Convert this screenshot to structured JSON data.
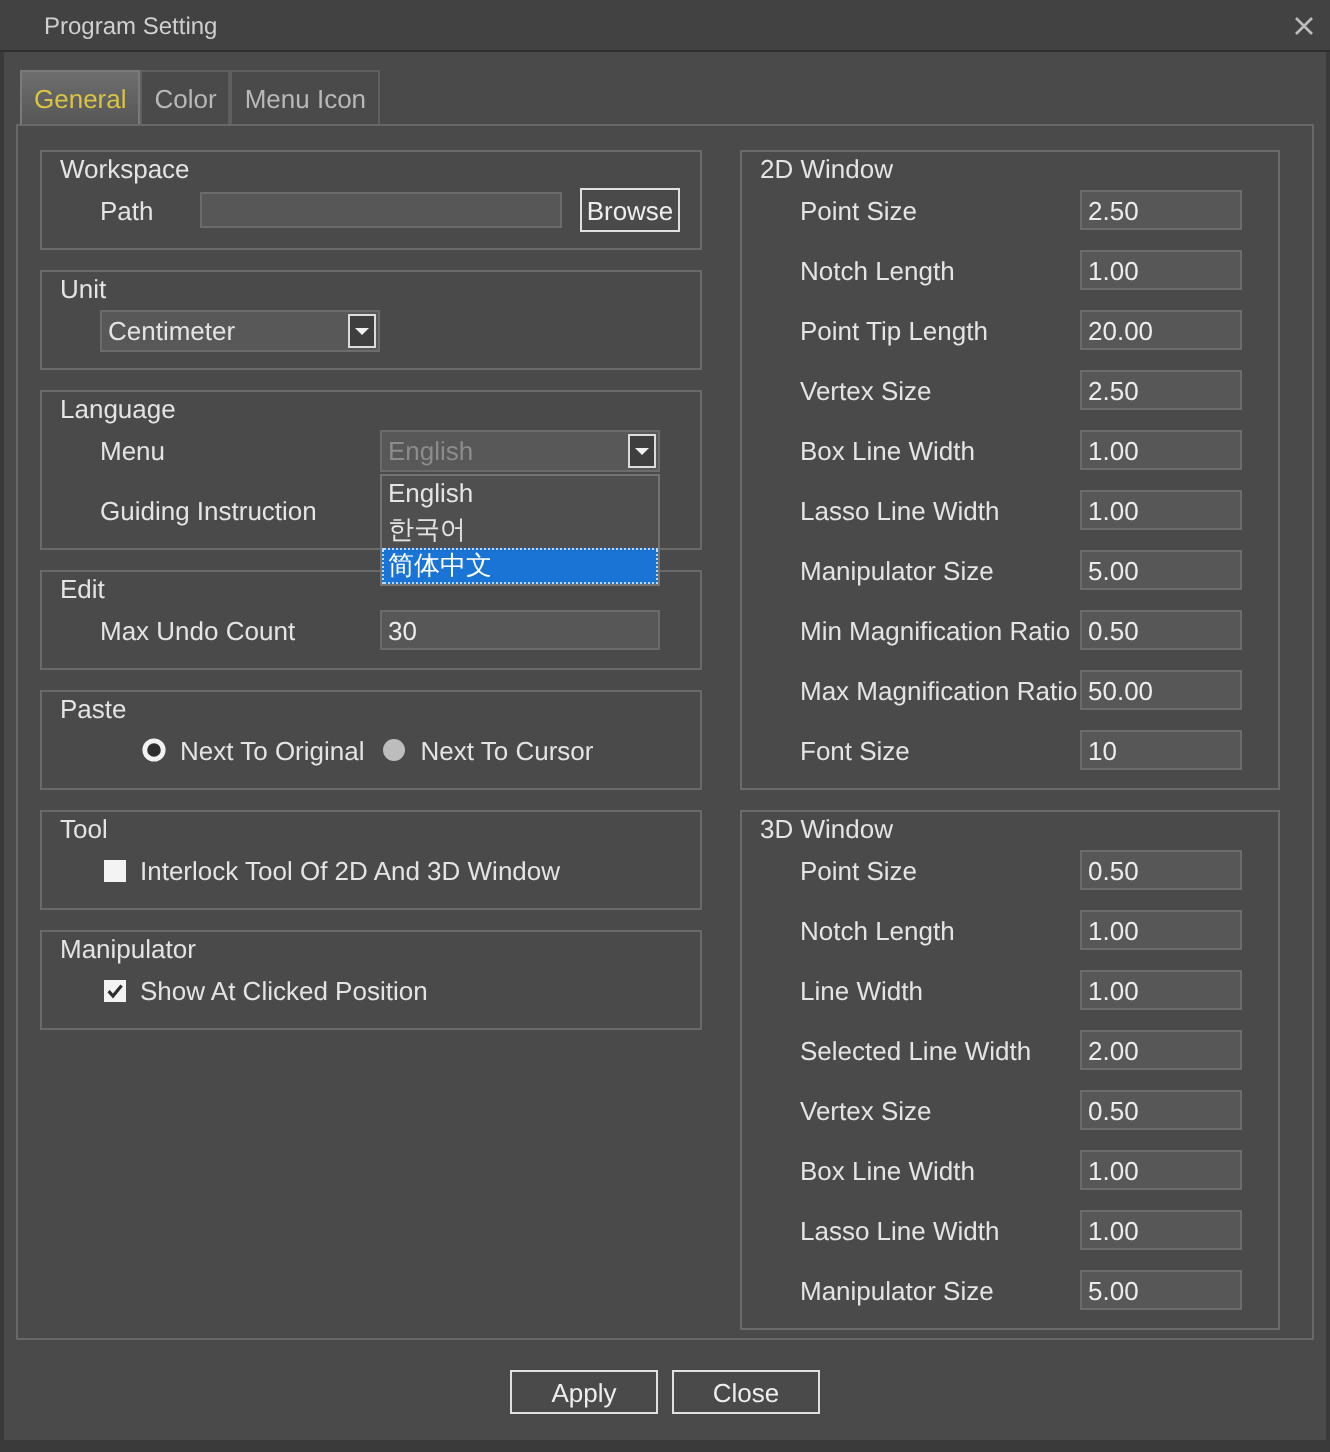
{
  "window": {
    "title": "Program Setting"
  },
  "tabs": [
    {
      "label": "General",
      "selected": true
    },
    {
      "label": "Color",
      "selected": false
    },
    {
      "label": "Menu Icon",
      "selected": false
    }
  ],
  "left_column": [
    {
      "title": "Workspace",
      "kind": "path",
      "label": "Path",
      "button": "Browse"
    },
    {
      "title": "Unit",
      "kind": "combo",
      "value": "Centimeter"
    },
    {
      "title": "Language",
      "kind": "combos",
      "rows": [
        {
          "label": "Menu",
          "value": "English",
          "disabled": true
        },
        {
          "label": "Guiding Instruction"
        }
      ],
      "popup": [
        {
          "label": "English",
          "selected": false
        },
        {
          "label": "한국어",
          "selected": false
        },
        {
          "label": "简体中文",
          "selected": true
        }
      ]
    },
    {
      "title": "Edit",
      "kind": "fields",
      "rows": [
        {
          "label": "Max Undo Count",
          "value": "30"
        }
      ]
    },
    {
      "title": "Paste",
      "kind": "radios",
      "options": [
        {
          "label": "Next To Original",
          "selected": true
        },
        {
          "label": "Next To Cursor",
          "selected": false
        }
      ]
    },
    {
      "title": "Tool",
      "kind": "checks",
      "options": [
        {
          "label": "Interlock Tool Of 2D And 3D Window",
          "checked": false
        }
      ]
    },
    {
      "title": "Manipulator",
      "kind": "checks",
      "options": [
        {
          "label": "Show At Clicked Position",
          "checked": true
        }
      ]
    }
  ],
  "right_column": [
    {
      "title": "2D Window",
      "kind": "fields",
      "rows": [
        {
          "label": "Point Size",
          "value": "2.50"
        },
        {
          "label": "Notch Length",
          "value": "1.00"
        },
        {
          "label": "Point Tip Length",
          "value": "20.00"
        },
        {
          "label": "Vertex Size",
          "value": "2.50"
        },
        {
          "label": "Box Line Width",
          "value": "1.00"
        },
        {
          "label": "Lasso Line Width",
          "value": "1.00"
        },
        {
          "label": "Manipulator Size",
          "value": "5.00"
        },
        {
          "label": "Min Magnification Ratio",
          "value": "0.50"
        },
        {
          "label": "Max Magnification Ratio",
          "value": "50.00"
        },
        {
          "label": "Font Size",
          "value": "10"
        }
      ]
    },
    {
      "title": "3D Window",
      "kind": "fields",
      "rows": [
        {
          "label": "Point Size",
          "value": "0.50"
        },
        {
          "label": "Notch Length",
          "value": "1.00"
        },
        {
          "label": "Line Width",
          "value": "1.00"
        },
        {
          "label": "Selected Line Width",
          "value": "2.00"
        },
        {
          "label": "Vertex Size",
          "value": "0.50"
        },
        {
          "label": "Box Line Width",
          "value": "1.00"
        },
        {
          "label": "Lasso Line Width",
          "value": "1.00"
        },
        {
          "label": "Manipulator Size",
          "value": "5.00"
        }
      ]
    }
  ],
  "buttons": [
    "Apply",
    "Close"
  ]
}
